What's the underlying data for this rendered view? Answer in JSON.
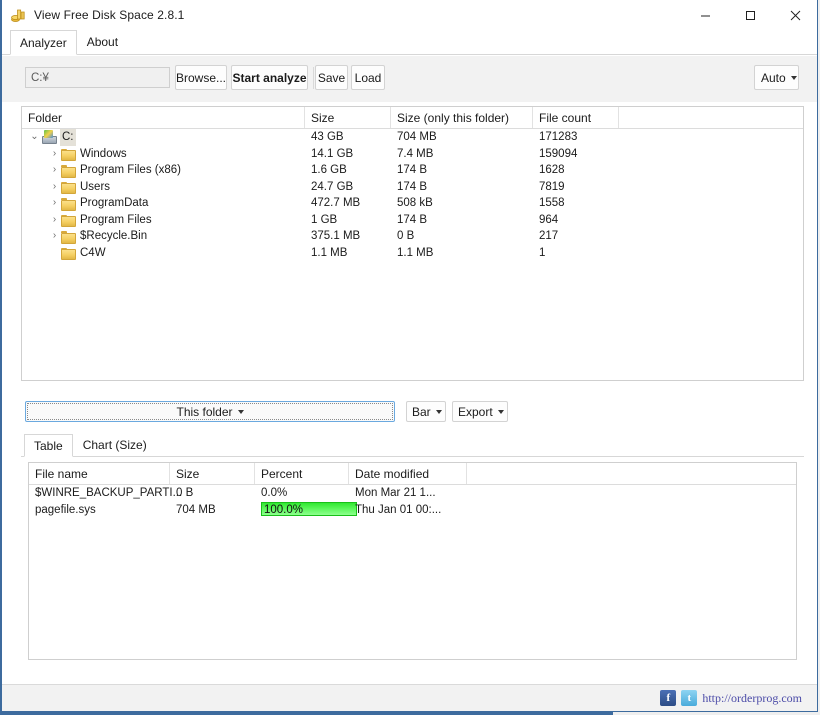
{
  "window": {
    "title": "View Free Disk Space 2.8.1",
    "app_icon": "coins-icon",
    "minimize_label": "─",
    "maximize_label": "☐",
    "close_label": "✕",
    "accent_color": "#3d6b9e"
  },
  "top_tabs": [
    {
      "label": "Analyzer",
      "active": true
    },
    {
      "label": "About",
      "active": false
    }
  ],
  "toolbar": {
    "path_value": "C:¥",
    "path_placeholder": "C:¥",
    "browse_label": "Browse...",
    "start_label": "Start analyze",
    "save_label": "Save",
    "load_label": "Load",
    "auto_label": "Auto"
  },
  "tree": {
    "columns": [
      "Folder",
      "Size",
      "Size (only this folder)",
      "File count"
    ],
    "rows": [
      {
        "name": "C:",
        "depth": 0,
        "icon": "drive-icon",
        "expander": "expanded",
        "selected": true,
        "size": "43 GB",
        "own": "704 MB",
        "count": "171283"
      },
      {
        "name": "Windows",
        "depth": 1,
        "icon": "folder-icon",
        "expander": "collapsed",
        "selected": false,
        "size": "14.1 GB",
        "own": "7.4 MB",
        "count": "159094"
      },
      {
        "name": "Program Files (x86)",
        "depth": 1,
        "icon": "folder-icon",
        "expander": "collapsed",
        "selected": false,
        "size": "1.6 GB",
        "own": "174 B",
        "count": "1628"
      },
      {
        "name": "Users",
        "depth": 1,
        "icon": "folder-icon",
        "expander": "collapsed",
        "selected": false,
        "size": "24.7 GB",
        "own": "174 B",
        "count": "7819"
      },
      {
        "name": "ProgramData",
        "depth": 1,
        "icon": "folder-icon",
        "expander": "collapsed",
        "selected": false,
        "size": "472.7 MB",
        "own": "508 kB",
        "count": "1558"
      },
      {
        "name": "Program Files",
        "depth": 1,
        "icon": "folder-icon",
        "expander": "collapsed",
        "selected": false,
        "size": "1 GB",
        "own": "174 B",
        "count": "964"
      },
      {
        "name": "$Recycle.Bin",
        "depth": 1,
        "icon": "folder-icon",
        "expander": "collapsed",
        "selected": false,
        "size": "375.1 MB",
        "own": "0 B",
        "count": "217"
      },
      {
        "name": "C4W",
        "depth": 1,
        "icon": "folder-icon",
        "expander": "none",
        "selected": false,
        "size": "1.1 MB",
        "own": "1.1 MB",
        "count": "1"
      }
    ]
  },
  "mid_controls": {
    "scope_label": "This folder",
    "chart_type_label": "Bar",
    "export_label": "Export"
  },
  "bottom_tabs": [
    {
      "label": "Table",
      "active": true
    },
    {
      "label": "Chart (Size)",
      "active": false
    }
  ],
  "file_table": {
    "columns": [
      "File name",
      "Size",
      "Percent",
      "Date modified"
    ],
    "rows": [
      {
        "name": "$WINRE_BACKUP_PARTI...",
        "size": "0 B",
        "percent": "0.0%",
        "percent_value": 0,
        "date": "Mon Mar 21 1..."
      },
      {
        "name": "pagefile.sys",
        "size": "704 MB",
        "percent": "100.0%",
        "percent_value": 100,
        "date": "Thu Jan 01 00:..."
      }
    ],
    "bar_color": "#32e832"
  },
  "status_bar": {
    "facebook_icon": "facebook-icon",
    "facebook_glyph": "f",
    "twitter_icon": "twitter-icon",
    "twitter_glyph": "t",
    "site_url": "http://orderprog.com",
    "link_color": "#4b4ba8"
  }
}
